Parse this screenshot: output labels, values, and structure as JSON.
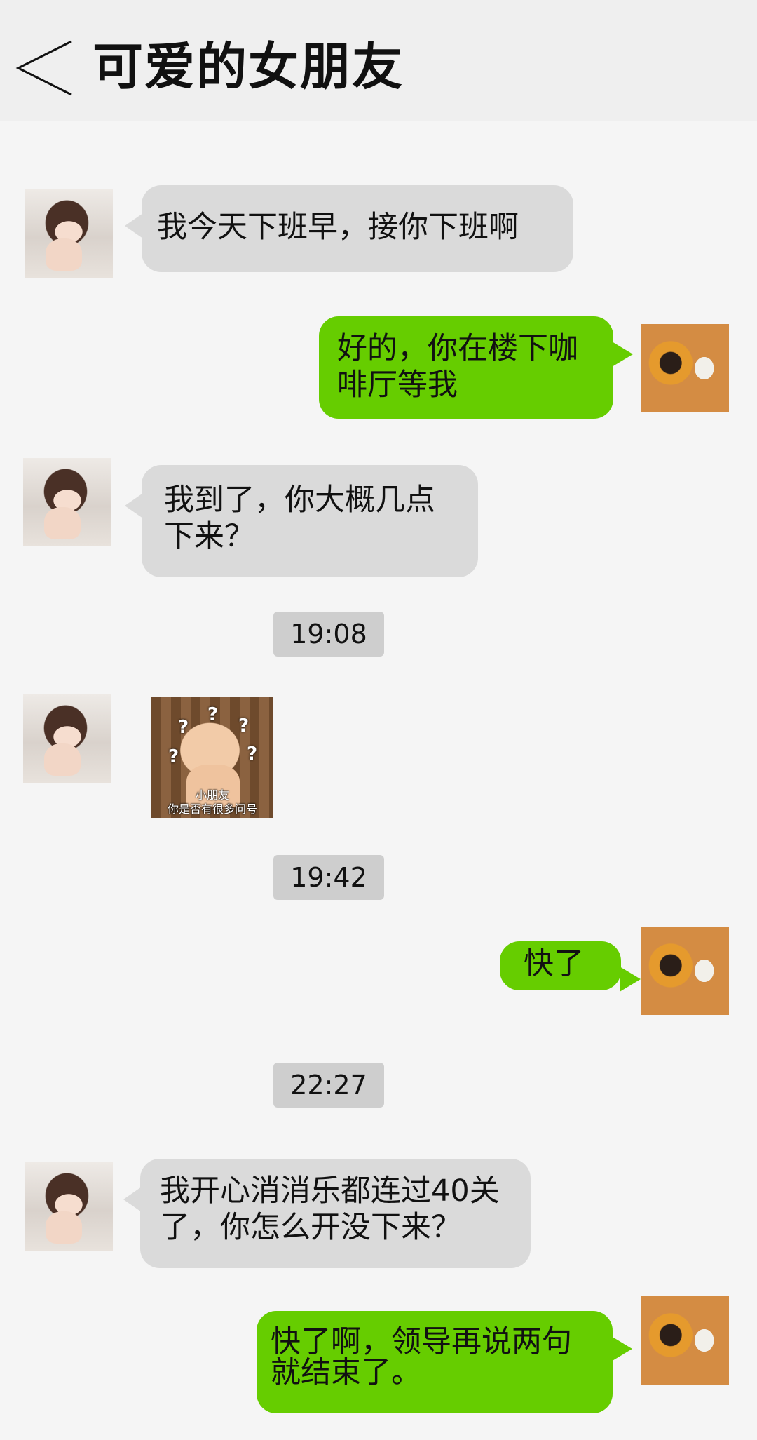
{
  "header": {
    "title": "可爱的女朋友",
    "back_icon": "chevron-left-icon"
  },
  "avatars": {
    "contact": "girl-portrait",
    "self": "dog-portrait"
  },
  "messages": [
    {
      "sender": "contact",
      "text": "我今天下班早，接你下班啊"
    },
    {
      "sender": "self",
      "text": "好的，你在楼下咖啡厅等我"
    },
    {
      "sender": "contact",
      "text": "我到了，你大概几点下来？"
    },
    {
      "sender": "contact",
      "type": "sticker",
      "caption_line1": "小朋友",
      "caption_line2": "你是否有很多问号"
    },
    {
      "sender": "self",
      "text": "快了"
    },
    {
      "sender": "contact",
      "text": "我开心消消乐都连过40关了，你怎么开没下来？"
    },
    {
      "sender": "self",
      "text": "快了啊，领导再说两句就结束了。"
    }
  ],
  "timestamps": [
    "19:08",
    "19:42",
    "22:27"
  ],
  "colors": {
    "background": "#f5f5f5",
    "header": "#efefef",
    "incoming_bubble": "#dadada",
    "outgoing_bubble": "#66cd00",
    "timestamp_bg": "#cecece"
  }
}
